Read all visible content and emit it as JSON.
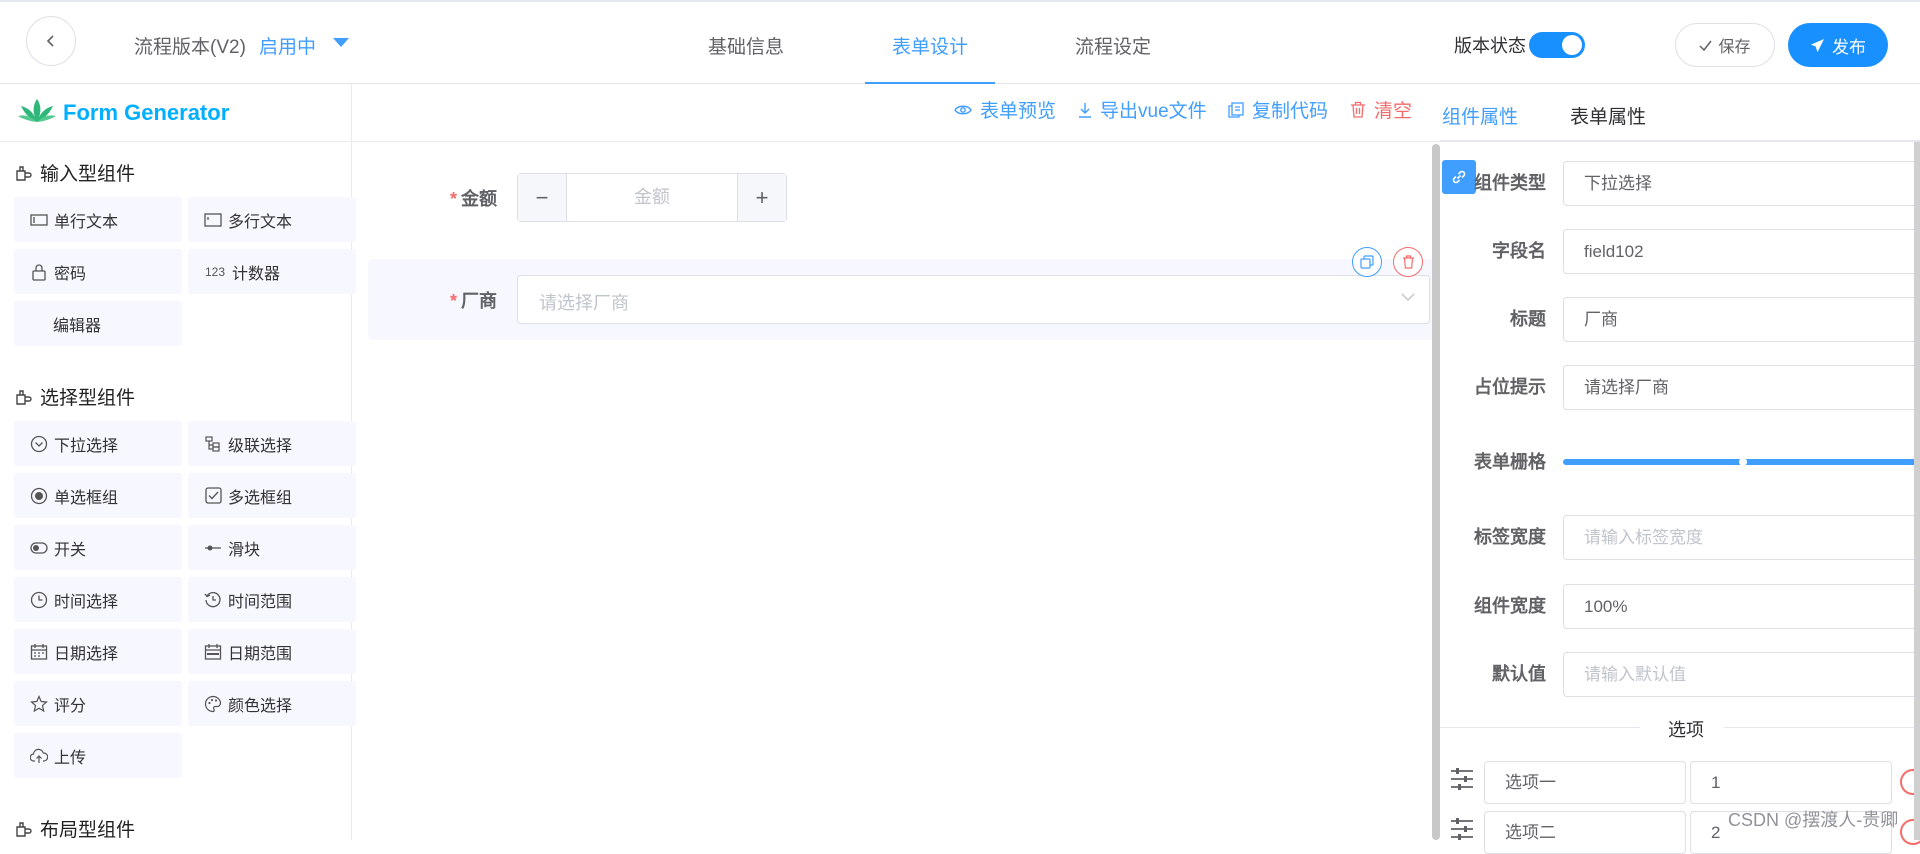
{
  "header": {
    "flow_title": "流程版本(V2)",
    "flow_status": "启用中",
    "tabs": [
      {
        "label": "基础信息"
      },
      {
        "label": "表单设计"
      },
      {
        "label": "流程设定"
      }
    ],
    "active_tab": "表单设计",
    "version_status_label": "版本状态",
    "version_status_on": true,
    "save_label": "保存",
    "publish_label": "发布"
  },
  "left": {
    "logo_text": "Form Generator",
    "groups": [
      {
        "title": "输入型组件",
        "items": [
          {
            "label": "单行文本",
            "icon": "input-icon"
          },
          {
            "label": "多行文本",
            "icon": "textarea-icon"
          },
          {
            "label": "密码",
            "icon": "lock-icon"
          },
          {
            "label": "计数器",
            "icon": "number-icon",
            "icon_text": "123"
          },
          {
            "label": "编辑器",
            "icon": "none"
          }
        ]
      },
      {
        "title": "选择型组件",
        "items": [
          {
            "label": "下拉选择",
            "icon": "chevron-circle-icon"
          },
          {
            "label": "级联选择",
            "icon": "cascader-icon"
          },
          {
            "label": "单选框组",
            "icon": "radio-icon"
          },
          {
            "label": "多选框组",
            "icon": "checkbox-icon"
          },
          {
            "label": "开关",
            "icon": "switch-icon"
          },
          {
            "label": "滑块",
            "icon": "slider-icon"
          },
          {
            "label": "时间选择",
            "icon": "clock-icon"
          },
          {
            "label": "时间范围",
            "icon": "time-range-icon"
          },
          {
            "label": "日期选择",
            "icon": "calendar-icon"
          },
          {
            "label": "日期范围",
            "icon": "date-range-icon"
          },
          {
            "label": "评分",
            "icon": "star-icon"
          },
          {
            "label": "颜色选择",
            "icon": "palette-icon"
          },
          {
            "label": "上传",
            "icon": "upload-icon"
          }
        ]
      },
      {
        "title": "布局型组件",
        "items": []
      }
    ]
  },
  "center": {
    "actions": [
      {
        "label": "表单预览",
        "icon": "eye-icon"
      },
      {
        "label": "导出vue文件",
        "icon": "download-icon"
      },
      {
        "label": "复制代码",
        "icon": "copy-icon"
      },
      {
        "label": "清空",
        "icon": "trash-icon"
      }
    ],
    "fields": [
      {
        "label": "金额",
        "required": true,
        "type": "stepper",
        "placeholder": "金额",
        "minus": "−",
        "plus": "+"
      },
      {
        "label": "厂商",
        "required": true,
        "type": "select",
        "placeholder": "请选择厂商"
      }
    ]
  },
  "right": {
    "tabs": [
      {
        "label": "组件属性"
      },
      {
        "label": "表单属性"
      }
    ],
    "active_tab": "组件属性",
    "props": {
      "type_label": "组件类型",
      "type_value": "下拉选择",
      "field_label": "字段名",
      "field_value": "field102",
      "title_label": "标题",
      "title_value": "厂商",
      "placeholder_label": "占位提示",
      "placeholder_value": "请选择厂商",
      "grid_label": "表单栅格",
      "grid_span": 24,
      "label_width_label": "标签宽度",
      "label_width_placeholder": "请输入标签宽度",
      "width_label": "组件宽度",
      "width_value": "100%",
      "default_label": "默认值",
      "default_placeholder": "请输入默认值"
    },
    "options_title": "选项",
    "options": [
      {
        "label": "选项一",
        "value": "1"
      },
      {
        "label": "选项二",
        "value": "2"
      }
    ]
  },
  "watermark": "CSDN @摆渡人-贵卿",
  "colors": {
    "primary": "#409eff",
    "danger": "#f56c6c",
    "logo": "#00afff"
  }
}
